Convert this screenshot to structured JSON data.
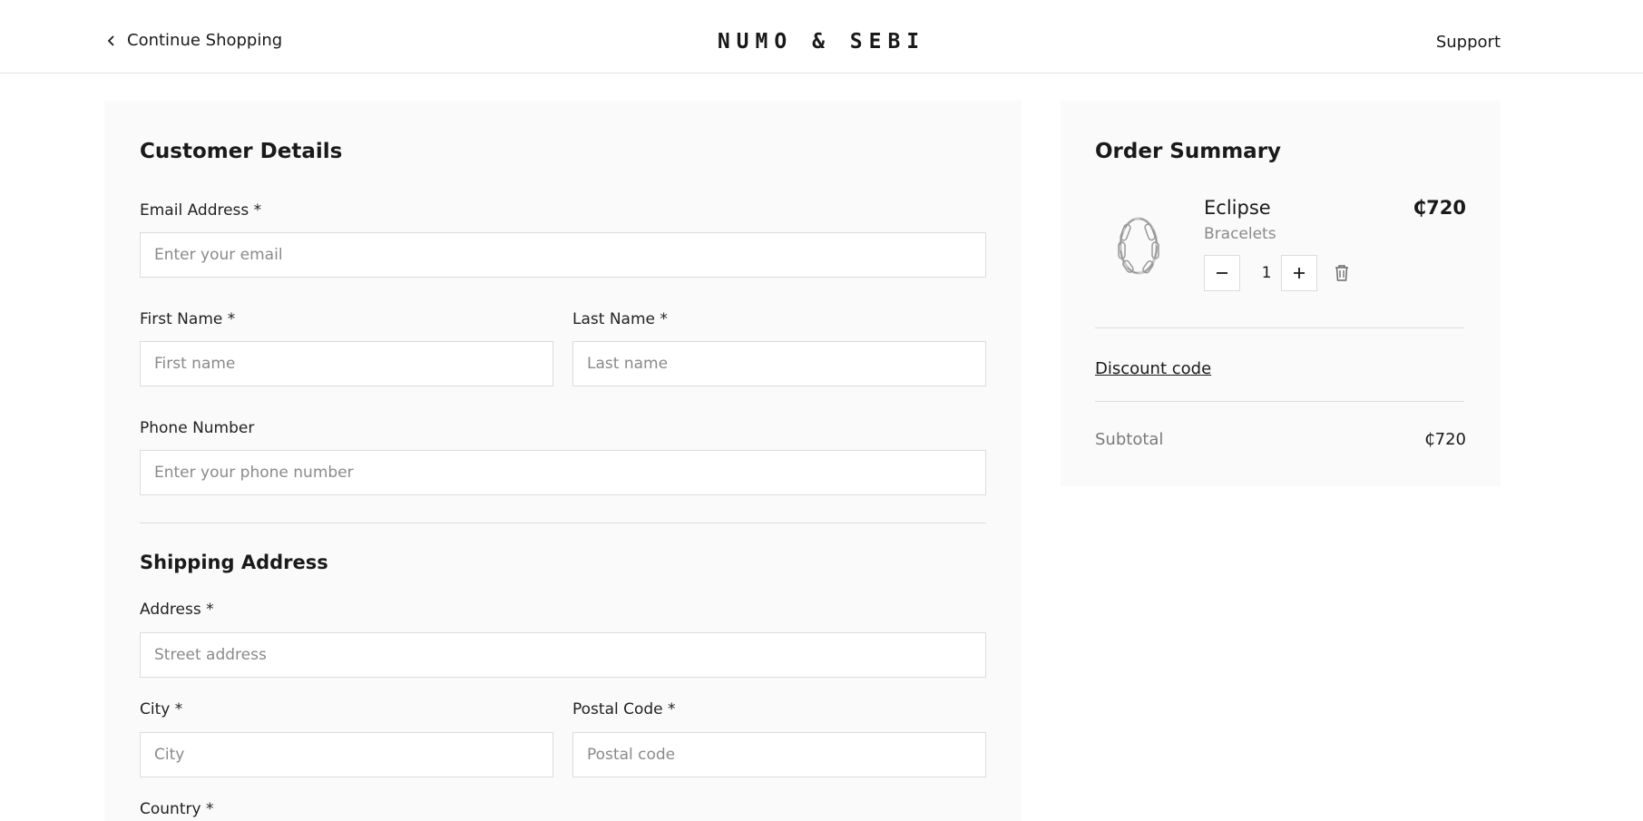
{
  "header": {
    "back_label": "Continue Shopping",
    "logo": "NUMO & SEBI",
    "support_label": "Support"
  },
  "customer_details": {
    "title": "Customer Details",
    "email": {
      "label": "Email Address *",
      "placeholder": "Enter your email",
      "value": ""
    },
    "first_name": {
      "label": "First Name *",
      "placeholder": "First name",
      "value": ""
    },
    "last_name": {
      "label": "Last Name *",
      "placeholder": "Last name",
      "value": ""
    },
    "phone": {
      "label": "Phone Number",
      "placeholder": "Enter your phone number",
      "value": ""
    }
  },
  "shipping_address": {
    "title": "Shipping Address",
    "address": {
      "label": "Address *",
      "placeholder": "Street address",
      "value": ""
    },
    "city": {
      "label": "City *",
      "placeholder": "City",
      "value": ""
    },
    "postal_code": {
      "label": "Postal Code *",
      "placeholder": "Postal code",
      "value": ""
    },
    "country": {
      "label": "Country *"
    }
  },
  "order_summary": {
    "title": "Order Summary",
    "item": {
      "name": "Eclipse",
      "category": "Bracelets",
      "price": "₵720",
      "quantity": "1",
      "image_icon": "chain-bracelet-icon"
    },
    "discount_label": "Discount code",
    "subtotal_label": "Subtotal",
    "subtotal_value": "₵720"
  },
  "icons": {
    "back": "chevron-left-icon",
    "minus": "minus-icon",
    "plus": "plus-icon",
    "remove": "trash-icon"
  }
}
